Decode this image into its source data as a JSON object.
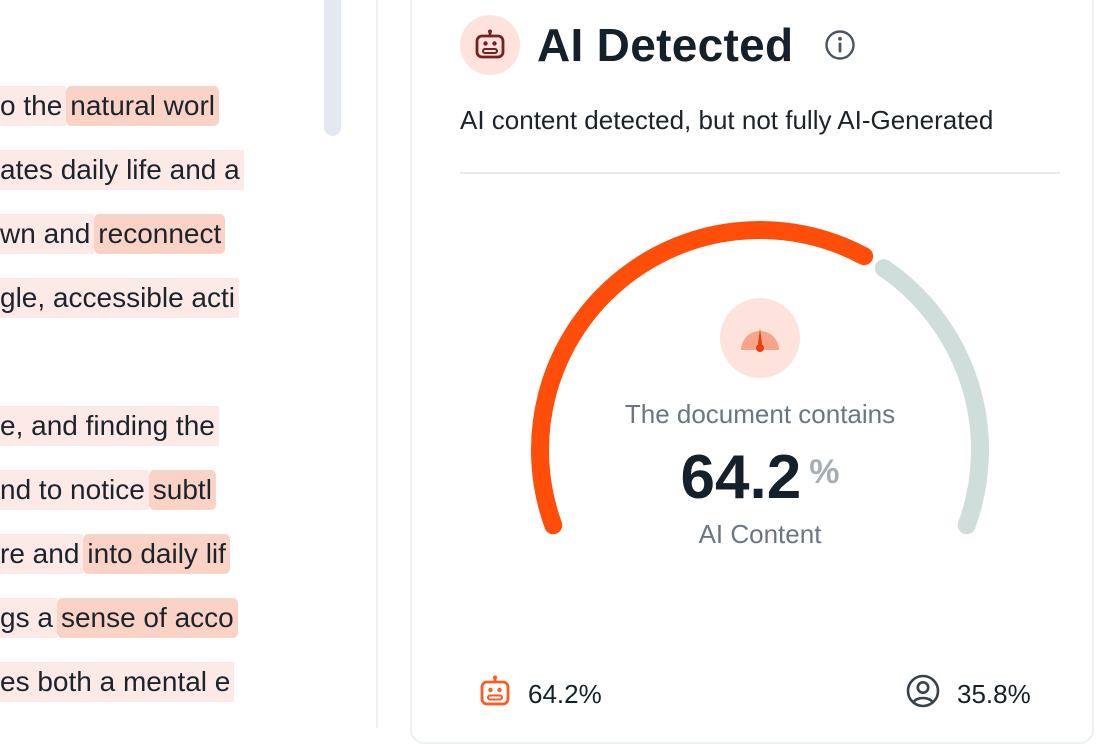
{
  "document": {
    "lines": [
      {
        "segments": [
          {
            "text": "o the",
            "level": "low"
          },
          {
            "text": "natural worl",
            "level": "high"
          }
        ]
      },
      {
        "segments": [
          {
            "text": "ates daily life and a",
            "level": "low"
          }
        ]
      },
      {
        "segments": [
          {
            "text": "wn and",
            "level": "low"
          },
          {
            "text": "reconnect",
            "level": "high"
          }
        ]
      },
      {
        "segments": [
          {
            "text": "gle, accessible acti",
            "level": "low"
          }
        ]
      },
      {
        "segments": []
      },
      {
        "segments": [
          {
            "text": "e, and finding the",
            "level": "low"
          }
        ]
      },
      {
        "segments": [
          {
            "text": "nd to notice",
            "level": "low"
          },
          {
            "text": "subtl",
            "level": "high"
          }
        ]
      },
      {
        "segments": [
          {
            "text": "re and",
            "level": "low"
          },
          {
            "text": "into daily lif",
            "level": "high"
          }
        ]
      },
      {
        "segments": [
          {
            "text": "gs a",
            "level": "low"
          },
          {
            "text": "sense of acco",
            "level": "high"
          }
        ]
      },
      {
        "segments": [
          {
            "text": "es both a mental e",
            "level": "low"
          }
        ]
      }
    ]
  },
  "result": {
    "title": "AI Detected",
    "subtitle": "AI content detected, but not fully AI-Generated",
    "gauge": {
      "caption": "The document contains",
      "value": "64.2",
      "unit": "%",
      "label": "AI Content",
      "ai_fraction": 0.642
    },
    "stats": {
      "ai_percent": "64.2%",
      "human_percent": "35.8%"
    }
  },
  "icons": {
    "header": "robot-icon",
    "info": "info-icon",
    "gauge": "speedometer-icon",
    "ai_stat": "robot-icon",
    "human_stat": "user-circle-icon"
  },
  "colors": {
    "ai_accent": "#ff4d0a",
    "human_track": "#cfdeda",
    "badge_bg": "#fde3dc",
    "highlight_low": "#fdeae6",
    "highlight_high": "#fbd3c6",
    "robot_dark": "#7a1f1f"
  }
}
